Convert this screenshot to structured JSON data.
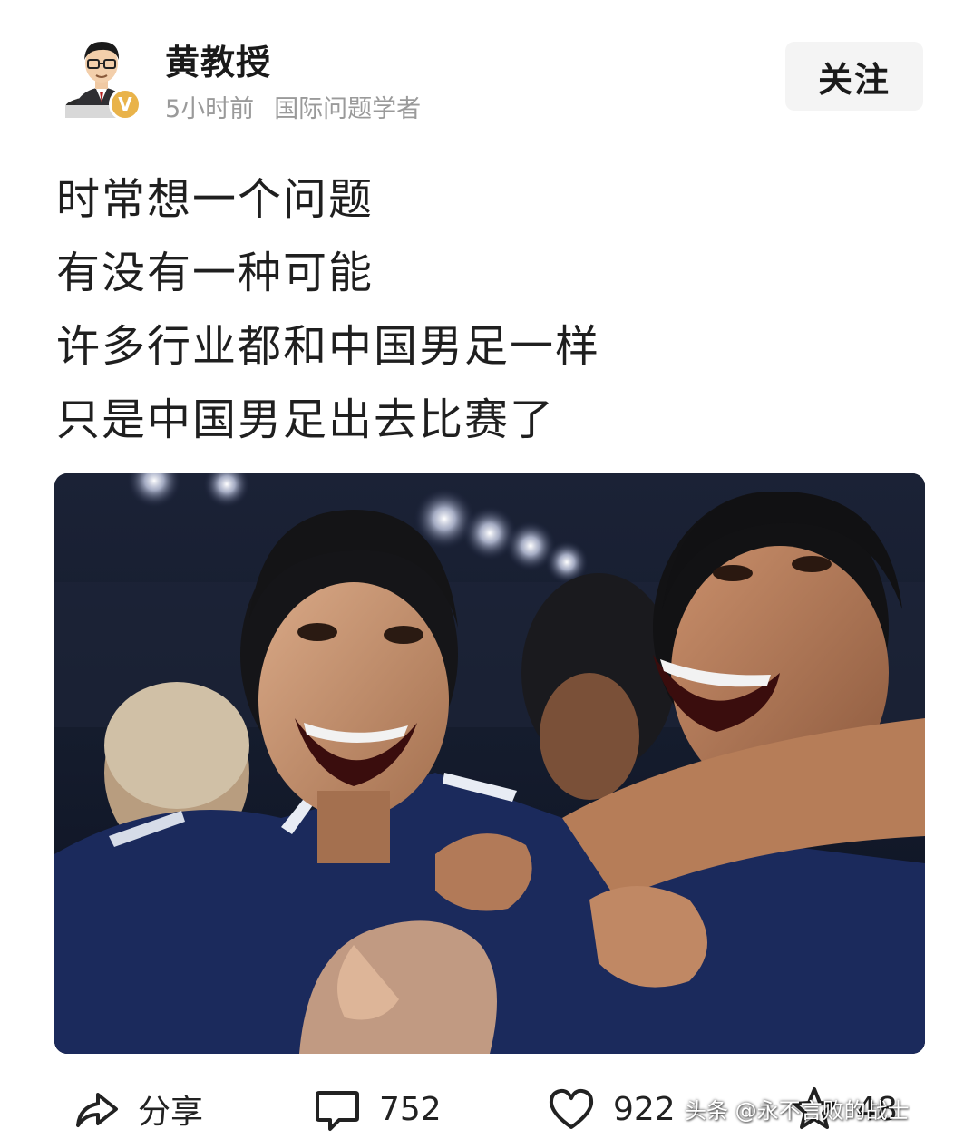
{
  "author": {
    "name": "黄教授",
    "time_ago": "5小时前",
    "title": "国际问题学者",
    "verified_badge": "V",
    "badge_color": "#e9b34a"
  },
  "follow_button": {
    "label": "关注"
  },
  "post": {
    "lines": [
      "时常想一个问题",
      "有没有一种可能",
      "许多行业都和中国男足一样",
      "只是中国男足出去比赛了"
    ]
  },
  "photo": {
    "icon": "photo-of-celebrating-football-players"
  },
  "actions": {
    "share": {
      "label": "分享",
      "icon": "share-arrow-icon"
    },
    "comment": {
      "count": "752",
      "icon": "comment-bubble-icon"
    },
    "like": {
      "count": "922",
      "icon": "heart-icon"
    },
    "favorite": {
      "count": "48",
      "icon": "star-icon"
    }
  },
  "watermark": "头条 @永不言败的战士"
}
